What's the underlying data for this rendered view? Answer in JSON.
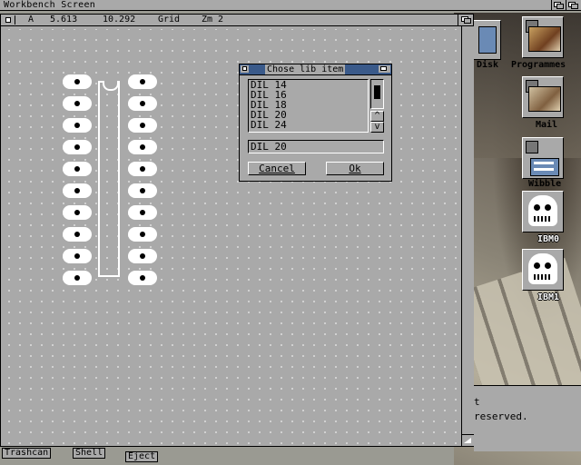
{
  "screen": {
    "title": "Workbench Screen"
  },
  "editor": {
    "layer": "A",
    "x": "5.613",
    "y": "10.292",
    "grid_label": "Grid",
    "zoom_label": "Zm 2",
    "component": {
      "pins_per_side": 10
    }
  },
  "dialog": {
    "title": "Chose lib item",
    "items": [
      "DIL 14",
      "DIL 16",
      "DIL 18",
      "DIL 20",
      "DIL 24"
    ],
    "scroll_up": "^",
    "scroll_down": "v",
    "input_value": "DIL 20",
    "cancel_label": "Cancel",
    "ok_label": "Ok"
  },
  "desktop_icons": [
    {
      "label": "Disk",
      "icon": "disk-icon"
    },
    {
      "label": "Programmes",
      "icon": "programmes-drawer-icon"
    },
    {
      "label": "Mail",
      "icon": "mail-drawer-icon"
    },
    {
      "label": "Wibble",
      "icon": "wibble-drawer-icon"
    },
    {
      "label": "IBM0",
      "icon": "skull-disk-icon"
    },
    {
      "label": "IBM1",
      "icon": "skull-disk-icon"
    }
  ],
  "dock": {
    "trashcan": "Trashcan",
    "shell": "Shell",
    "eject": "Eject"
  },
  "shell": {
    "line1": "t",
    "line2": "reserved."
  }
}
